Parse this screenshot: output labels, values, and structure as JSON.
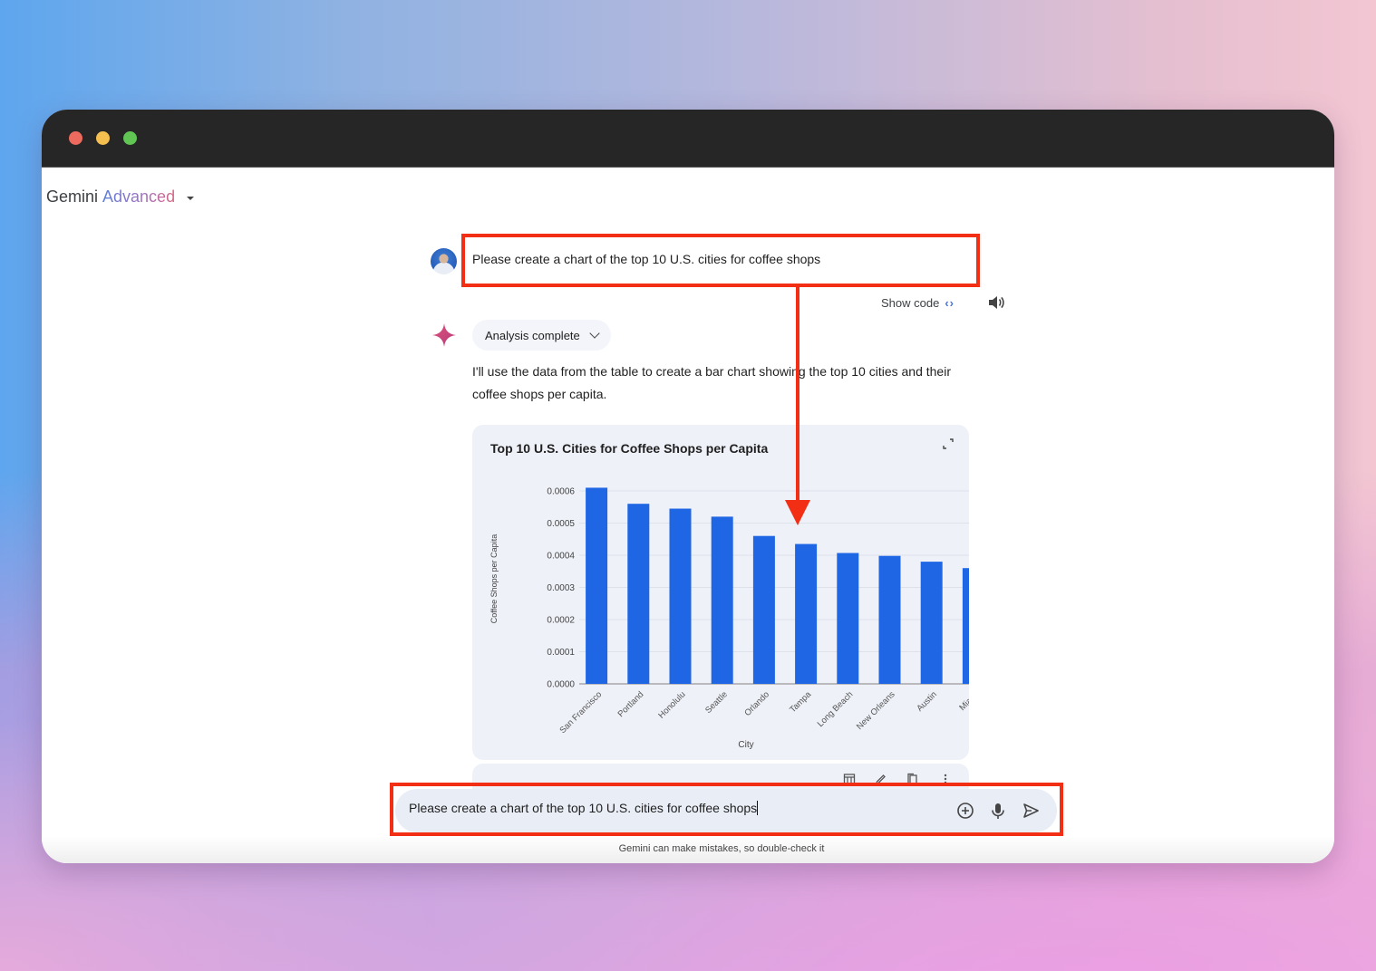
{
  "window": {
    "controls": [
      "close",
      "minimize",
      "maximize"
    ],
    "colors": {
      "close": "#ec6a5e",
      "minimize": "#f4bf4f",
      "maximize": "#61c554",
      "titlebar": "#262626"
    }
  },
  "header": {
    "app_name": "Gemini",
    "tier": "Advanced",
    "dropdown_icon": "caret-down-icon"
  },
  "conversation": {
    "user_prompt": "Please create a chart of the top 10 U.S. cities for coffee shops",
    "show_code_label": "Show code",
    "analysis_chip_label": "Analysis complete",
    "response_text": "I'll use the data from the table to create a bar chart showing the top 10 cities and their coffee shops per capita."
  },
  "chart_card": {
    "actions": [
      "table-icon",
      "edit-icon",
      "copy-icon",
      "more-vert-icon"
    ]
  },
  "chart_data": {
    "type": "bar",
    "title": "Top 10 U.S. Cities for Coffee Shops per Capita",
    "xlabel": "City",
    "ylabel": "Coffee Shops per Capita",
    "categories": [
      "San Francisco",
      "Portland",
      "Honolulu",
      "Seattle",
      "Orlando",
      "Tampa",
      "Long Beach",
      "New Orleans",
      "Austin",
      "Miami"
    ],
    "values": [
      0.00061,
      0.00056,
      0.000545,
      0.00052,
      0.00046,
      0.000435,
      0.000407,
      0.000398,
      0.00038,
      0.00036
    ],
    "ylim": [
      0,
      0.0006
    ],
    "yticks": [
      "0.0000",
      "0.0001",
      "0.0002",
      "0.0003",
      "0.0004",
      "0.0005",
      "0.0006"
    ],
    "ytick_values": [
      0,
      0.0001,
      0.0002,
      0.0003,
      0.0004,
      0.0005,
      0.0006
    ],
    "grid": true,
    "bar_color": "#1f66e5"
  },
  "input": {
    "value": "Please create a chart of the top 10 U.S. cities for coffee shops",
    "icons": [
      "add-circle-icon",
      "mic-icon",
      "send-icon"
    ]
  },
  "footer": {
    "disclaimer": "Gemini can make mistakes, so double-check it"
  },
  "annotation": {
    "color": "#f22e14"
  }
}
